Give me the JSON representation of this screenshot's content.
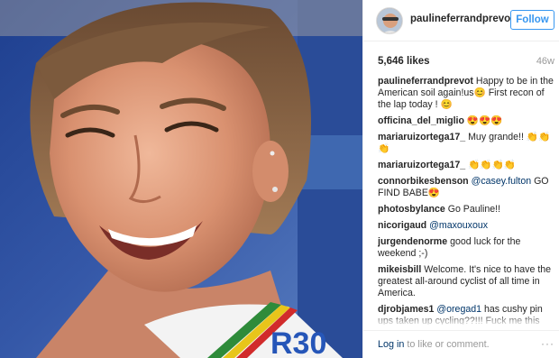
{
  "post": {
    "username": "paulineferrandprevot",
    "follow_label": "Follow",
    "likes": "5,646 likes",
    "age": "46w"
  },
  "comments": [
    {
      "user": "paulineferrandprevot",
      "parts": [
        {
          "t": "text",
          "v": "Happy to be in the American soil again!us😊 First recon of the lap today ! 😊"
        }
      ]
    },
    {
      "user": "officina_del_miglio",
      "parts": [
        {
          "t": "text",
          "v": "😍😍😍"
        }
      ]
    },
    {
      "user": "mariaruizortega17_",
      "parts": [
        {
          "t": "text",
          "v": "Muy grande!! 👏👏👏"
        }
      ]
    },
    {
      "user": "mariaruizortega17_",
      "parts": [
        {
          "t": "text",
          "v": "👏👏👏👏"
        }
      ]
    },
    {
      "user": "connorbikesbenson",
      "parts": [
        {
          "t": "mention",
          "v": "@casey.fulton"
        },
        {
          "t": "text",
          "v": " GO FIND BABE😍"
        }
      ]
    },
    {
      "user": "photosbylance",
      "parts": [
        {
          "t": "text",
          "v": "Go Pauline!!"
        }
      ]
    },
    {
      "user": "nicorigaud",
      "parts": [
        {
          "t": "mention",
          "v": "@maxouxoux"
        }
      ]
    },
    {
      "user": "jurgendenorme",
      "parts": [
        {
          "t": "text",
          "v": "good luck for the weekend ;-)"
        }
      ]
    },
    {
      "user": "mikeisbill",
      "parts": [
        {
          "t": "text",
          "v": "Welcome. It's nice to have the greatest all-around cyclist of all time in America."
        }
      ]
    },
    {
      "user": "djrobjames1",
      "parts": [
        {
          "t": "mention",
          "v": "@oregad1"
        },
        {
          "t": "text",
          "v": " has cushy pin ups taken up cycling??!!! Fuck me this sport is gathering momentum from us norries"
        }
      ]
    }
  ],
  "footer": {
    "login_link": "Log in",
    "login_rest": " to like or comment.",
    "more_icon": "···"
  },
  "photo": {
    "jersey_text": "R30",
    "icon": "portrait-photo"
  }
}
